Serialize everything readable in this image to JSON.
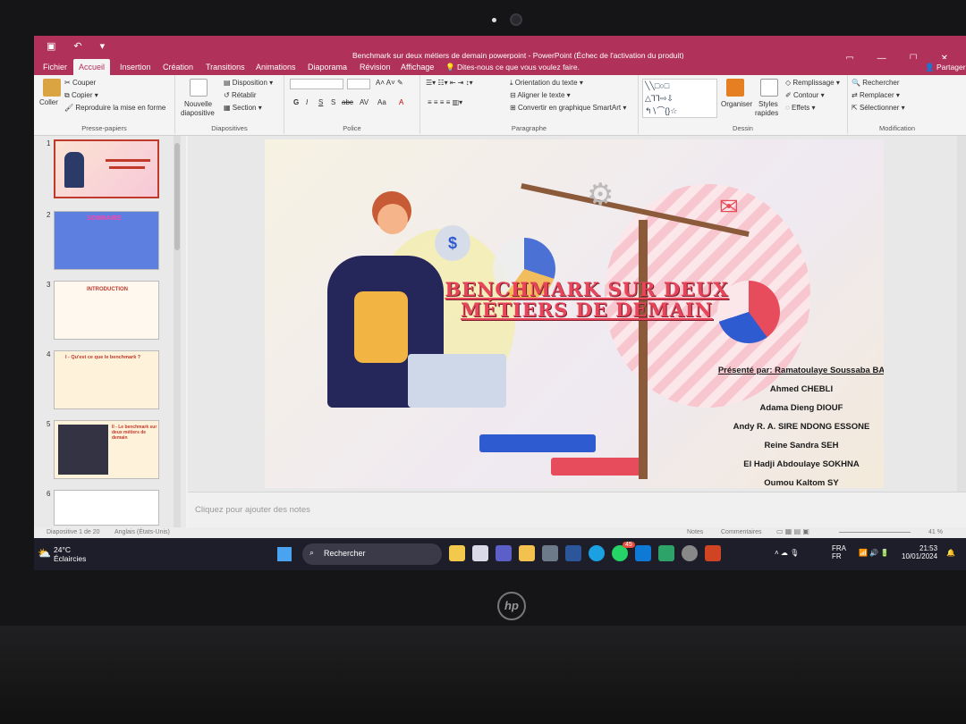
{
  "window": {
    "title": "Benchmark sur deux métiers de demain powerpoint - PowerPoint (Échec de l'activation du produit)"
  },
  "tabs": [
    "Fichier",
    "Accueil",
    "Insertion",
    "Création",
    "Transitions",
    "Animations",
    "Diaporama",
    "Révision",
    "Affichage"
  ],
  "tell_me": "Dites-nous ce que vous voulez faire.",
  "share": "Partager",
  "ribbon": {
    "clipboard": {
      "paste": "Coller",
      "cut": "Couper",
      "copy": "Copier",
      "format_painter": "Reproduire la mise en forme",
      "label": "Presse-papiers"
    },
    "slides": {
      "new": "Nouvelle",
      "new2": "diapositive",
      "layout": "Disposition",
      "reset": "Rétablir",
      "section": "Section",
      "label": "Diapositives"
    },
    "font": {
      "label": "Police",
      "bold": "G",
      "italic": "I",
      "underline": "S",
      "shadow": "S",
      "strike": "abc",
      "spacing": "AV",
      "case": "Aa",
      "color": "A"
    },
    "paragraph": {
      "direction": "Orientation du texte",
      "align": "Aligner le texte",
      "smartart": "Convertir en graphique SmartArt",
      "label": "Paragraphe"
    },
    "drawing": {
      "arrange": "Organiser",
      "styles": "Styles",
      "styles2": "rapides",
      "fill": "Remplissage",
      "outline": "Contour",
      "effects": "Effets",
      "label": "Dessin"
    },
    "editing": {
      "find": "Rechercher",
      "replace": "Remplacer",
      "select": "Sélectionner",
      "label": "Modification"
    }
  },
  "thumbnails": [
    {
      "num": "1",
      "title": ""
    },
    {
      "num": "2",
      "title": "SOMMAIRE"
    },
    {
      "num": "3",
      "title": "INTRODUCTION"
    },
    {
      "num": "4",
      "title": "I - Qu'est ce que le benchmark ?"
    },
    {
      "num": "5",
      "title": "II - Le benchmark sur deux métiers de demain"
    },
    {
      "num": "6",
      "title": ""
    }
  ],
  "slide": {
    "title_line1": "BENCHMARK SUR DEUX",
    "title_line2": "MÉTIERS DE DEMAIN",
    "presented_by": "Présenté par: Ramatoulaye Soussaba BA",
    "authors": [
      "Ahmed CHEBLI",
      "Adama Dieng DIOUF",
      "Andy R. A. SIRE NDONG ESSONE",
      "Reine Sandra SEH",
      "El Hadji Abdoulaye SOKHNA",
      "Oumou Kaltom SY"
    ]
  },
  "notes_placeholder": "Cliquez pour ajouter des notes",
  "status": {
    "slide": "Diapositive 1 de 20",
    "language": "Anglais (États-Unis)",
    "notes": "Notes",
    "comments": "Commentaires",
    "zoom": "41 %"
  },
  "taskbar": {
    "temp": "24°C",
    "weather": "Éclaircies",
    "search": "Rechercher",
    "lang1": "FRA",
    "lang2": "FR",
    "time": "21:53",
    "date": "10/01/2024",
    "badge": "45"
  },
  "colors": {
    "accent": "#b0315a",
    "title": "#e8455a"
  }
}
